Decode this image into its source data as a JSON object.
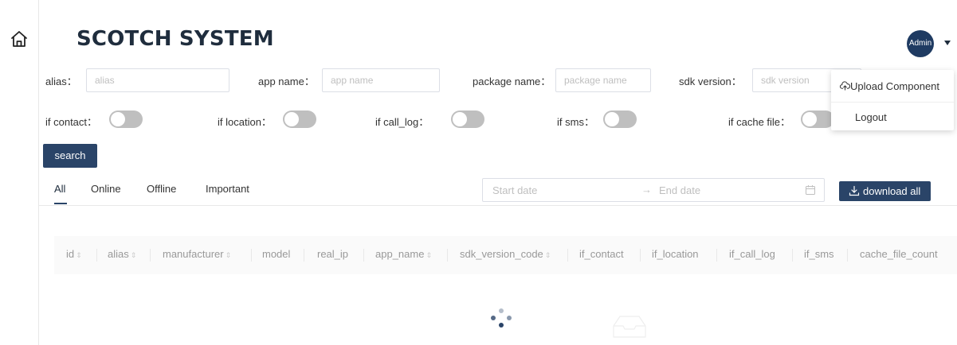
{
  "app": {
    "title": "SCOTCH SYSTEM"
  },
  "user": {
    "avatar_label": "Admin"
  },
  "filters": {
    "alias_label": "alias：",
    "alias_placeholder": "alias",
    "app_name_label": "app name：",
    "app_name_placeholder": "app name",
    "package_name_label": "package name：",
    "package_name_placeholder": "package name",
    "sdk_version_label": "sdk version：",
    "sdk_version_placeholder": "sdk version",
    "if_contact_label": "if contact：",
    "if_location_label": "if location：",
    "if_call_log_label": "if call_log：",
    "if_sms_label": "if sms：",
    "if_cache_file_label": "if cache file：",
    "search_label": "search"
  },
  "toggles": {
    "if_contact": false,
    "if_location": false,
    "if_call_log": false,
    "if_sms": false,
    "if_cache_file": false
  },
  "tabs": [
    {
      "label": "All",
      "active": true
    },
    {
      "label": "Online",
      "active": false
    },
    {
      "label": "Offline",
      "active": false
    },
    {
      "label": "Important",
      "active": false
    }
  ],
  "date_range": {
    "start_placeholder": "Start date",
    "arrow": "→",
    "end_placeholder": "End date"
  },
  "download_label": "download all",
  "table": {
    "columns": [
      "id",
      "alias",
      "manufacturer",
      "model",
      "real_ip",
      "app_name",
      "sdk_version_code",
      "if_contact",
      "if_location",
      "if_call_log",
      "if_sms",
      "cache_file_count"
    ],
    "sortable": [
      "id",
      "alias",
      "manufacturer",
      "app_name",
      "sdk_version_code"
    ]
  },
  "user_menu": {
    "items": [
      "Upload Component",
      "Logout"
    ]
  },
  "colors": {
    "primary": "#2a4468",
    "toggle_off": "#bfbfbf",
    "header_bg": "#fafafa"
  }
}
